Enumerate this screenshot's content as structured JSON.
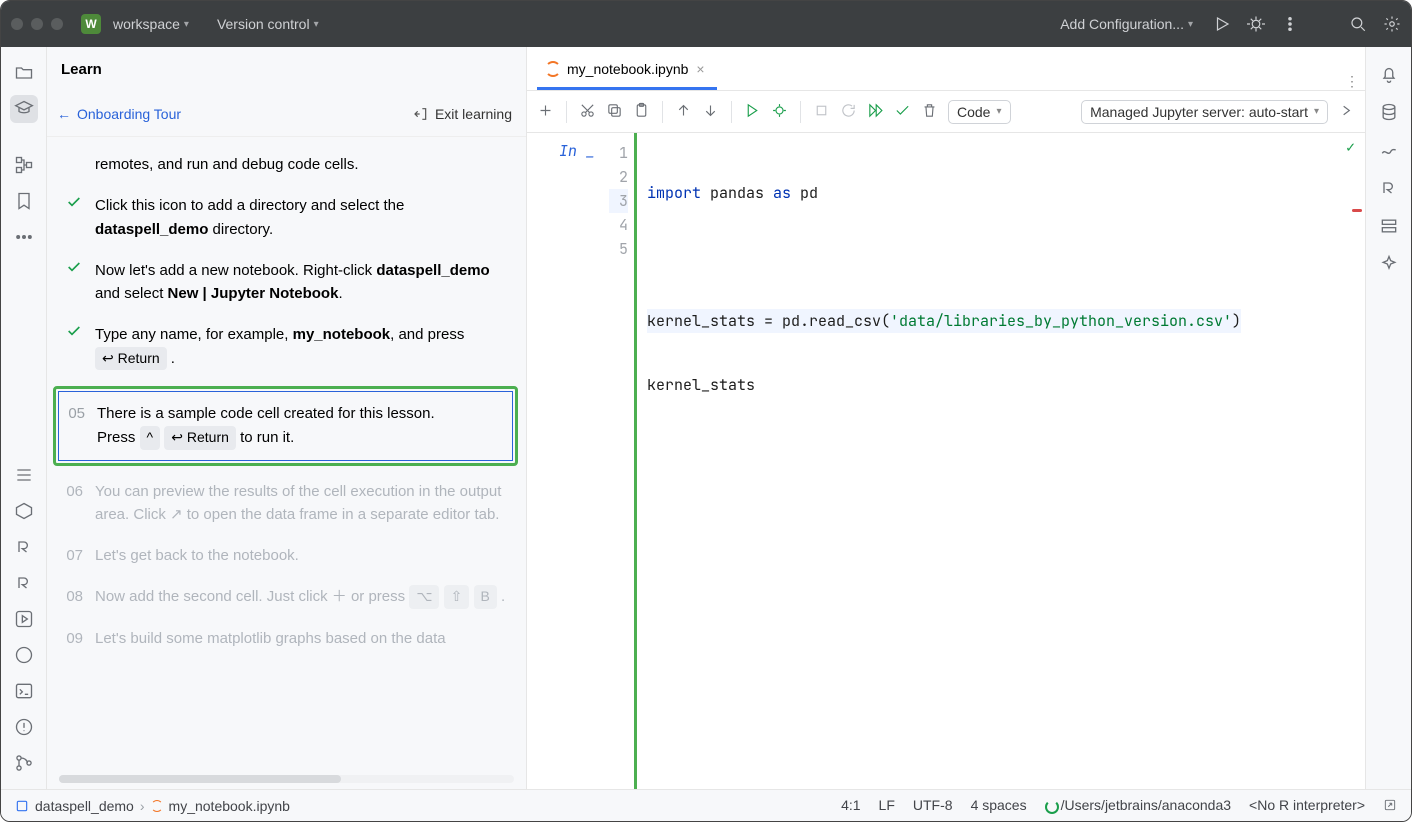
{
  "titlebar": {
    "workspace_badge": "W",
    "workspace_label": "workspace",
    "vcs_label": "Version control",
    "add_config_label": "Add Configuration..."
  },
  "learn": {
    "heading": "Learn",
    "back_label": "Onboarding Tour",
    "exit_label": "Exit learning",
    "steps": {
      "s0": {
        "text": "remotes, and run and debug code cells."
      },
      "s1": {
        "prefix": "Click this icon to add a directory and select the ",
        "bold": "dataspell_demo",
        "suffix": " directory."
      },
      "s2": {
        "prefix": "Now let's add a new notebook. Right-click ",
        "b1": "dataspell_demo",
        "mid": " and select ",
        "b2": "New | Jupyter Notebook",
        "suffix": "."
      },
      "s3": {
        "prefix": "Type any name, for example, ",
        "b1": "my_notebook",
        "mid": ", and press ",
        "kbd": "↩ Return",
        "suffix": " ."
      },
      "s5": {
        "num": "05",
        "line1": "There is a sample code cell created for this lesson.",
        "line2a": "Press ",
        "k1": "^",
        "k2": "↩ Return",
        "line2b": " to run it."
      },
      "s6": {
        "num": "06",
        "text": "You can preview the results of the cell execution in the output area. Click ↗ to open the data frame in a separate editor tab."
      },
      "s7": {
        "num": "07",
        "text": "Let's get back to the notebook."
      },
      "s8": {
        "num": "08",
        "prefix": "Now add the second cell. Just click ＋ or press ",
        "k1": "⌥",
        "k2": "⇧",
        "k3": "B",
        "suffix": " ."
      },
      "s9": {
        "num": "09",
        "text": "Let's build some matplotlib graphs based on the data"
      }
    }
  },
  "editor": {
    "tab_name": "my_notebook.ipynb",
    "cell_type_label": "Code",
    "server_label": "Managed Jupyter server: auto-start",
    "in_label": "In _",
    "lines": {
      "l1": {
        "n": "1"
      },
      "l2": {
        "n": "2"
      },
      "l3": {
        "n": "3"
      },
      "l4": {
        "n": "4"
      },
      "l5": {
        "n": "5"
      }
    },
    "code": {
      "l1_import": "import",
      "l1_pandas": " pandas ",
      "l1_as": "as",
      "l1_pd": " pd",
      "l3_a": "kernel_stats = pd.read_csv(",
      "l3_str": "'data/libraries_by_python_version.csv'",
      "l3_b": ")",
      "l4": "kernel_stats"
    }
  },
  "status": {
    "crumb1": "dataspell_demo",
    "crumb2": "my_notebook.ipynb",
    "pos": "4:1",
    "eol": "LF",
    "enc": "UTF-8",
    "indent": "4 spaces",
    "interp": "/Users/jetbrains/anaconda3",
    "r": "<No R interpreter>"
  }
}
